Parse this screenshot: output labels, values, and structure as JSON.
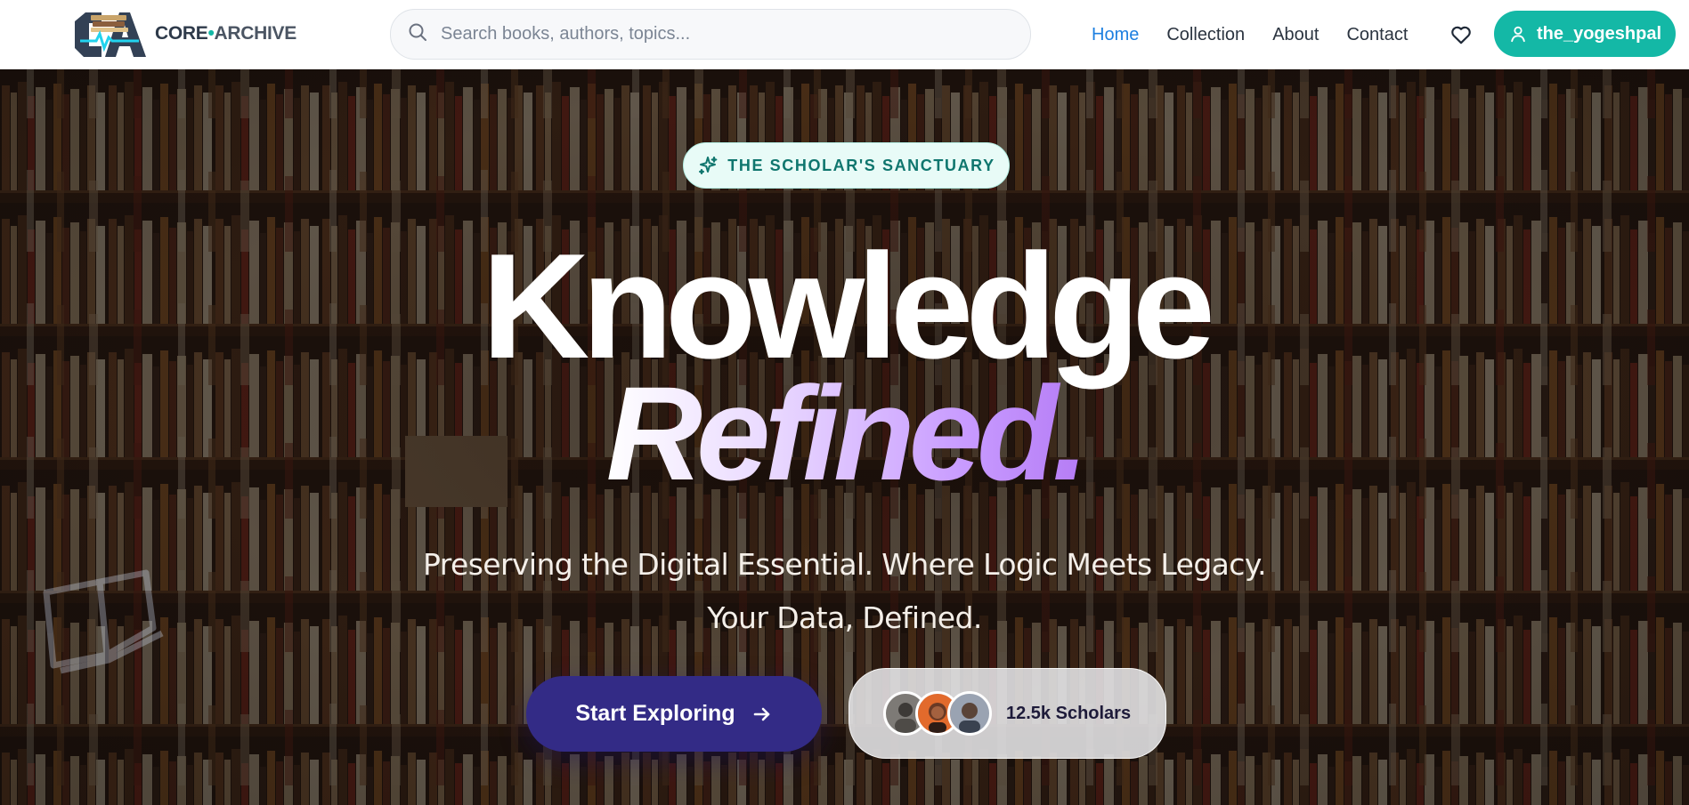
{
  "brand": {
    "mark_icon": "core-archive-logo",
    "name_part1": "CORE",
    "name_part2": "ARCHIVE"
  },
  "search": {
    "placeholder": "Search books, authors, topics...",
    "icon": "search-icon"
  },
  "nav": {
    "links": [
      {
        "label": "Home",
        "active": true
      },
      {
        "label": "Collection",
        "active": false
      },
      {
        "label": "About",
        "active": false
      },
      {
        "label": "Contact",
        "active": false
      }
    ],
    "favorites_icon": "heart-icon",
    "user": {
      "label": "the_yogeshpal",
      "icon": "user-icon"
    }
  },
  "hero": {
    "badge": {
      "label": "THE SCHOLAR'S SANCTUARY",
      "icon": "sparkle-icon"
    },
    "headline_line1": "Knowledge",
    "headline_line2": "Refined.",
    "subtitle_line1": "Preserving the Digital Essential. Where Logic Meets Legacy.",
    "subtitle_line2": "Your Data, Defined.",
    "cta": {
      "label": "Start Exploring",
      "icon": "arrow-right-icon"
    },
    "scholars": {
      "label": "12.5k Scholars",
      "avatar_count": 3
    }
  },
  "colors": {
    "accent_teal": "#14b8a6",
    "nav_active": "#1d7fe0",
    "cta_indigo": "#332b86",
    "headline_gradient_end": "#b57cf5"
  }
}
